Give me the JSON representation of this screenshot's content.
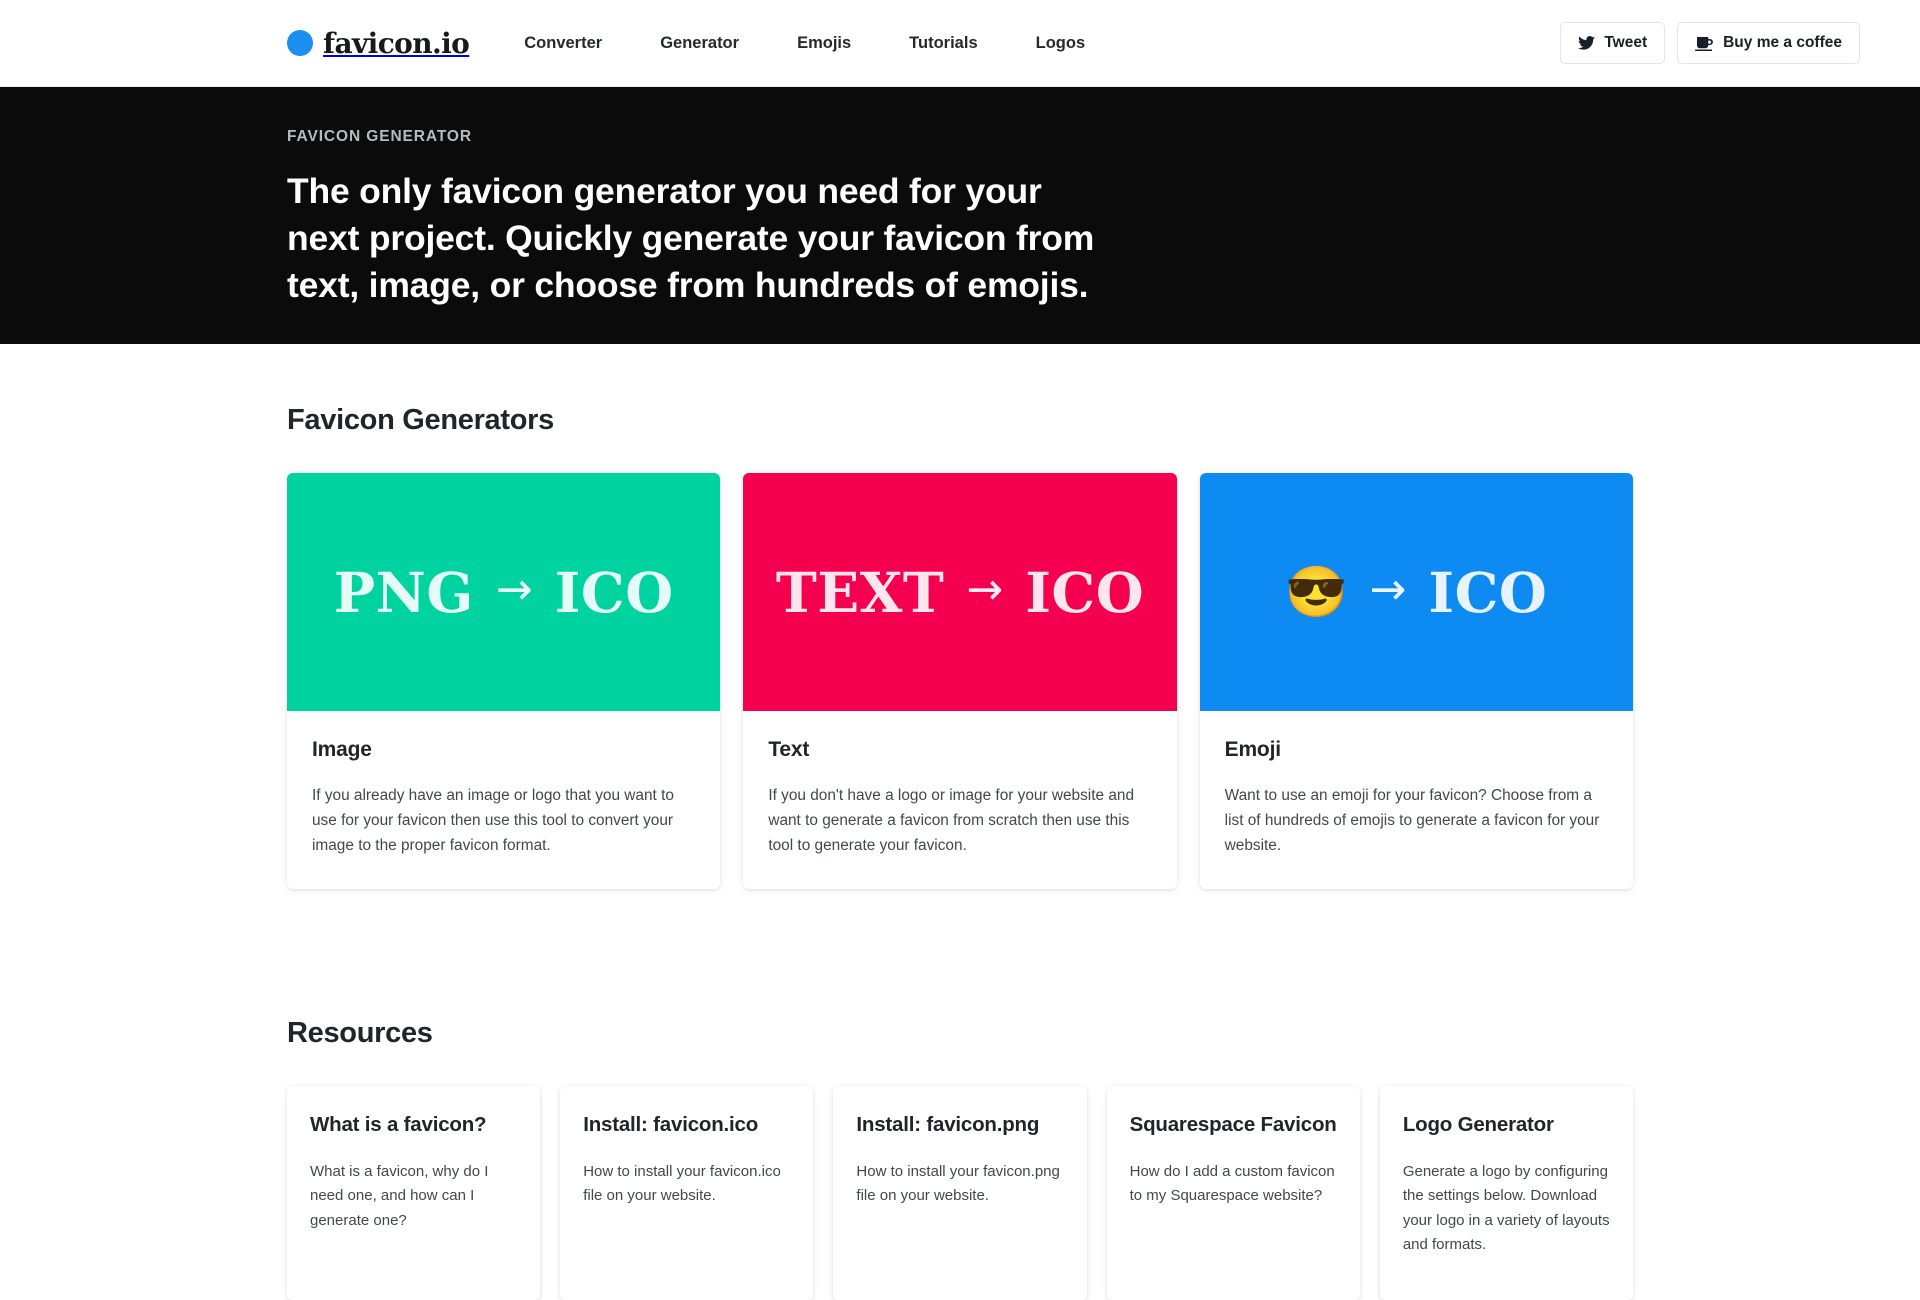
{
  "navbar": {
    "brand": {
      "name": "favicon.io",
      "dot_color": "#1a8fef"
    },
    "links": [
      {
        "label": "Converter"
      },
      {
        "label": "Generator"
      },
      {
        "label": "Emojis"
      },
      {
        "label": "Tutorials"
      },
      {
        "label": "Logos"
      }
    ],
    "actions": [
      {
        "label": "Tweet",
        "icon": "twitter-bird-icon"
      },
      {
        "label": "Buy me a coffee",
        "icon": "coffee-cup-icon"
      }
    ]
  },
  "hero": {
    "eyebrow": "FAVICON GENERATOR",
    "title": "The only favicon generator you need for your next project. Quickly generate your favicon from text, image, or choose from hundreds of emojis.",
    "background": "#0b0b0b"
  },
  "generators": {
    "heading": "Favicon Generators",
    "cards": [
      {
        "banner": {
          "from": "PNG",
          "arrow": "→",
          "to": "ICO",
          "color": "#00d3a0",
          "type": "text"
        },
        "title": "Image",
        "desc": "If you already have an image or logo that you want to use for your favicon then use this tool to convert your image to the proper favicon format."
      },
      {
        "banner": {
          "from": "TEXT",
          "arrow": "→",
          "to": "ICO",
          "color": "#f5004f",
          "type": "text"
        },
        "title": "Text",
        "desc": "If you don't have a logo or image for your website and want to generate a favicon from scratch then use this tool to generate your favicon."
      },
      {
        "banner": {
          "from": "😎",
          "arrow": "→",
          "to": "ICO",
          "color": "#0d8bf2",
          "type": "emoji"
        },
        "title": "Emoji",
        "desc": "Want to use an emoji for your favicon? Choose from a list of hundreds of emojis to generate a favicon for your website."
      }
    ]
  },
  "resources": {
    "heading": "Resources",
    "cards": [
      {
        "title": "What is a favicon?",
        "desc": "What is a favicon, why do I need one, and how can I generate one?"
      },
      {
        "title": "Install: favicon.ico",
        "desc": "How to install your favicon.ico file on your website."
      },
      {
        "title": "Install: favicon.png",
        "desc": "How to install your favicon.png file on your website."
      },
      {
        "title": "Squarespace Favicon",
        "desc": "How do I add a custom favicon to my Squarespace website?"
      },
      {
        "title": "Logo Generator",
        "desc": "Generate a logo by configuring the settings below. Download your logo in a variety of layouts and formats."
      }
    ]
  }
}
